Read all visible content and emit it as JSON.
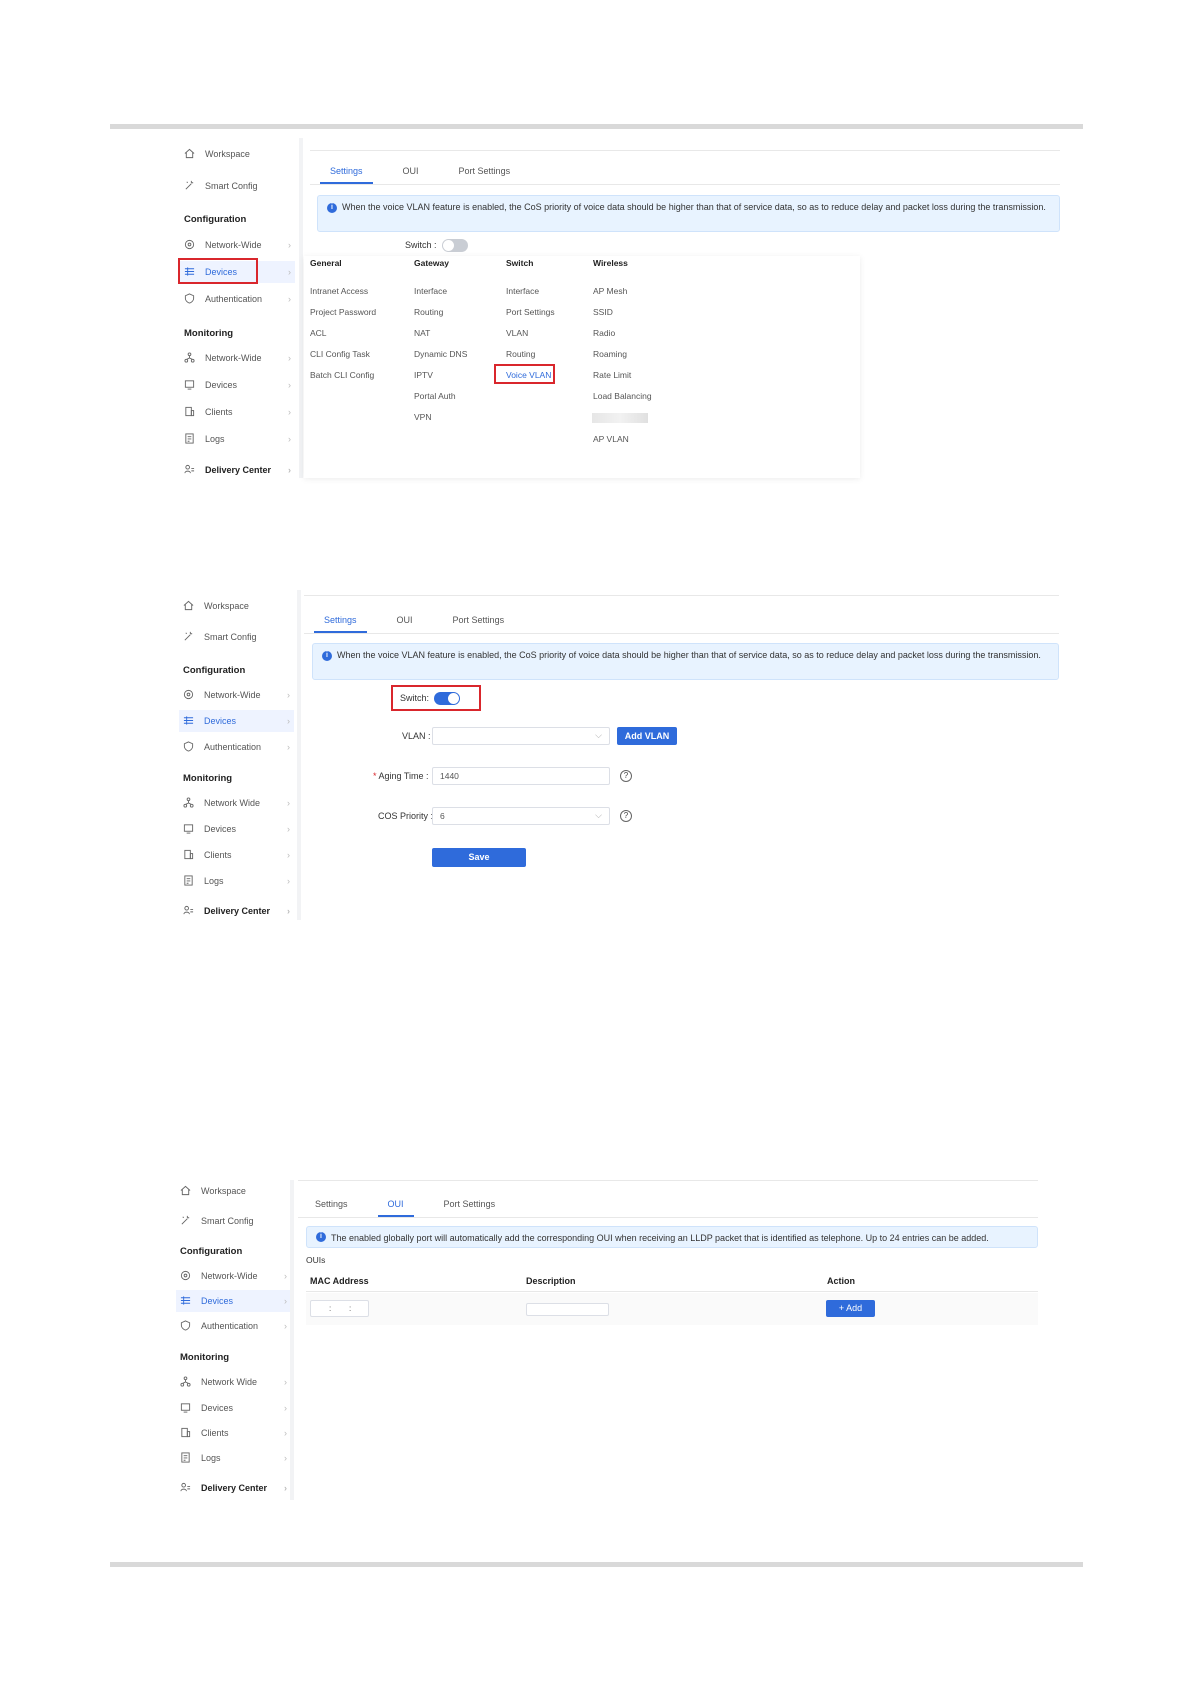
{
  "sidebar": {
    "workspace": "Workspace",
    "smart_config": "Smart Config",
    "configuration": "Configuration",
    "network_wide": "Network-Wide",
    "devices": "Devices",
    "authentication": "Authentication",
    "monitoring": "Monitoring",
    "mon_network_wide": "Network-Wide",
    "mon_network_wide_alt": "Network Wide",
    "mon_devices": "Devices",
    "clients": "Clients",
    "logs": "Logs",
    "delivery_center": "Delivery Center",
    "chevron": "›"
  },
  "tabs": {
    "settings": "Settings",
    "oui": "OUI",
    "port_settings": "Port Settings"
  },
  "notice_vlan": "When the voice VLAN feature is enabled, the CoS priority of voice data should be higher than that of service data, so as to reduce delay and packet loss during the transmission.",
  "notice_oui": "The enabled globally port will automatically add the corresponding OUI when receiving an LLDP packet that is identified as telephone. Up to 24 entries can be added.",
  "switch_label": "Switch :",
  "switch_label_2": "Switch:",
  "menu": {
    "general": {
      "title": "General",
      "items": [
        "Intranet Access",
        "Project Password",
        "ACL",
        "CLI Config Task",
        "Batch CLI Config"
      ]
    },
    "gateway": {
      "title": "Gateway",
      "items": [
        "Interface",
        "Routing",
        "NAT",
        "Dynamic DNS",
        "IPTV",
        "Portal Auth",
        "VPN"
      ]
    },
    "switch": {
      "title": "Switch",
      "items": [
        "Interface",
        "Port Settings",
        "VLAN",
        "Routing",
        "Voice VLAN"
      ]
    },
    "wireless": {
      "title": "Wireless",
      "items": [
        "AP Mesh",
        "SSID",
        "Radio",
        "Roaming",
        "Rate Limit",
        "Load Balancing",
        "AP VLAN"
      ]
    }
  },
  "form": {
    "vlan_label": "VLAN :",
    "vlan_value": "",
    "add_vlan": "Add VLAN",
    "aging_label": "Aging Time :",
    "aging_value": "1440",
    "required_mark": "*",
    "cos_label": "COS Priority :",
    "cos_value": "6",
    "save": "Save",
    "help": "?",
    "dropdown": "⌵"
  },
  "oui": {
    "section": "OUIs",
    "col_mac": "MAC Address",
    "col_desc": "Description",
    "col_action": "Action",
    "add": "+ Add",
    "mac_sep": ":"
  },
  "colors": {
    "accent": "#2f6bdb",
    "highlight": "#d9262c",
    "notice_bg": "#e8f3ff"
  },
  "icons": [
    "home-icon",
    "magic-icon",
    "globe-icon",
    "devices-icon",
    "shield-icon",
    "network-icon",
    "monitor-icon",
    "clients-icon",
    "logs-icon",
    "delivery-icon",
    "info-icon",
    "chevron-right-icon"
  ]
}
